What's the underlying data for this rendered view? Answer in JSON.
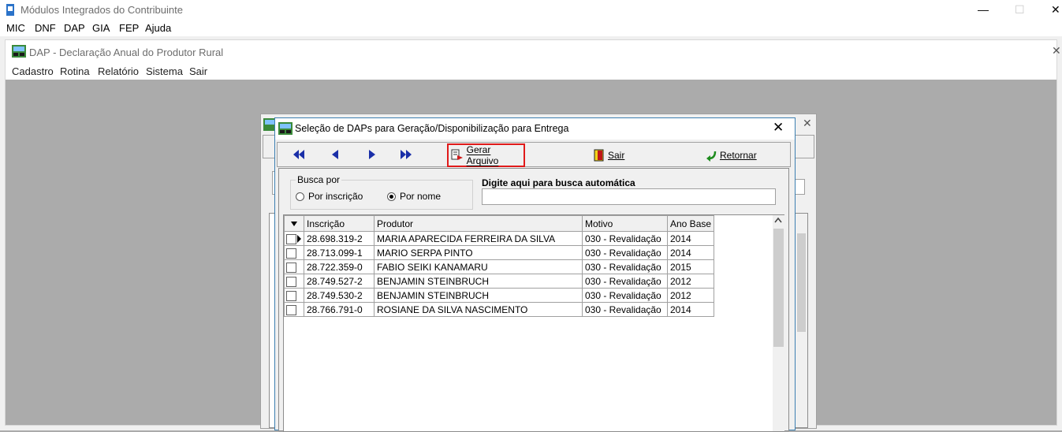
{
  "app": {
    "title": "Módulos Integrados do Contribuinte",
    "menu": [
      {
        "label": "MIC"
      },
      {
        "label": "DNF"
      },
      {
        "label": "DAP"
      },
      {
        "label": "GIA"
      },
      {
        "label": "FEP"
      },
      {
        "label": "Ajuda"
      }
    ],
    "minimize": "—",
    "maximize": "☐",
    "close": "✕"
  },
  "mdi": {
    "title": "DAP - Declaração Anual do Produtor Rural",
    "close": "✕",
    "menu": [
      {
        "label": "Cadastro"
      },
      {
        "label": "Rotina"
      },
      {
        "label": "Relatório"
      },
      {
        "label": "Sistema"
      },
      {
        "label": "Sair"
      }
    ]
  },
  "bg_form": {
    "close": "✕"
  },
  "dialog": {
    "title": "Seleção de DAPs para Geração/Disponibilização para Entrega",
    "close": "✕",
    "toolbar": {
      "gerar": "Gerar Arquivo",
      "sair": "Sair",
      "retornar": "Retornar"
    },
    "busca": {
      "legend": "Busca por",
      "option_inscricao": "Por inscrição",
      "option_nome": "Por nome",
      "selected": "Por nome"
    },
    "auto_search": {
      "label": "Digite aqui para busca automática",
      "value": ""
    },
    "grid": {
      "columns": [
        "",
        "Inscrição",
        "Produtor",
        "Motivo",
        "Ano Base"
      ],
      "rows": [
        {
          "inscricao": "28.698.319-2",
          "produtor": "MARIA APARECIDA FERREIRA DA SILVA",
          "motivo": "030 - Revalidação",
          "ano": "2014",
          "current": true
        },
        {
          "inscricao": "28.713.099-1",
          "produtor": "MARIO SERPA PINTO",
          "motivo": "030 - Revalidação",
          "ano": "2014"
        },
        {
          "inscricao": "28.722.359-0",
          "produtor": "FABIO SEIKI KANAMARU",
          "motivo": "030 - Revalidação",
          "ano": "2015"
        },
        {
          "inscricao": "28.749.527-2",
          "produtor": "BENJAMIN STEINBRUCH",
          "motivo": "030 - Revalidação",
          "ano": "2012"
        },
        {
          "inscricao": "28.749.530-2",
          "produtor": "BENJAMIN STEINBRUCH",
          "motivo": "030 - Revalidação",
          "ano": "2012"
        },
        {
          "inscricao": "28.766.791-0",
          "produtor": "ROSIANE DA SILVA NASCIMENTO",
          "motivo": "030 - Revalidação",
          "ano": "2014"
        }
      ]
    }
  }
}
